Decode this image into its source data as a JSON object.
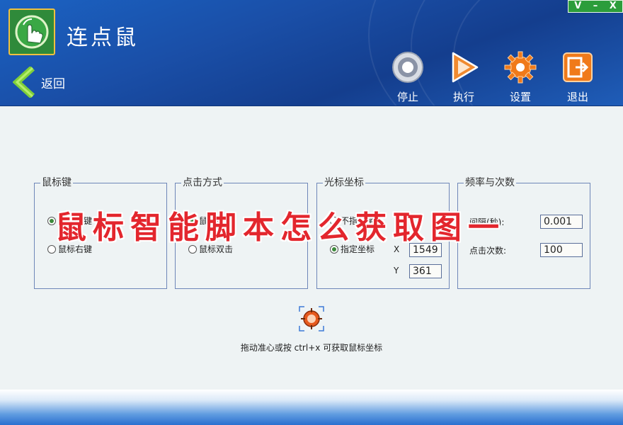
{
  "app": {
    "title": "连点鼠"
  },
  "window_controls": {
    "restore": "V",
    "minimize": "–",
    "close": "X"
  },
  "nav": {
    "back_label": "返回"
  },
  "toolbar": {
    "stop_label": "停止",
    "run_label": "执行",
    "settings_label": "设置",
    "exit_label": "退出"
  },
  "groups": {
    "mouse_button": {
      "title": "鼠标键",
      "options": [
        {
          "label": "鼠标左键",
          "selected": true
        },
        {
          "label": "鼠标右键",
          "selected": false
        }
      ]
    },
    "click_mode": {
      "title": "点击方式",
      "options": [
        {
          "label": "鼠标单击",
          "selected": true
        },
        {
          "label": "鼠标双击",
          "selected": false
        }
      ]
    },
    "cursor_coords": {
      "title": "光标坐标",
      "options": [
        {
          "label": "不指定坐标",
          "selected": false
        },
        {
          "label": "指定坐标",
          "selected": true
        }
      ],
      "x_label": "X",
      "x_value": "1549",
      "y_label": "Y",
      "y_value": "361"
    },
    "frequency": {
      "title": "频率与次数",
      "interval_label": "间隔(秒):",
      "interval_value": "0.001",
      "count_label": "点击次数:",
      "count_value": "100"
    }
  },
  "hint": "拖动准心或按 ctrl+x 可获取鼠标坐标",
  "overlay_caption": "鼠标智能脚本怎么获取图一",
  "colors": {
    "header_blue": "#1a4fa8",
    "accent_orange": "#f07a1a",
    "overlay_red": "#e3262d",
    "titlebar_green": "#2c9d3b"
  }
}
